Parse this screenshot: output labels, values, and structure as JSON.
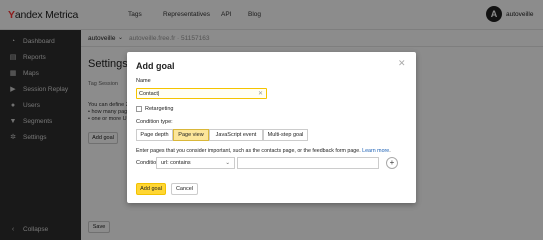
{
  "header": {
    "logo_y": "Y",
    "logo_rest": "andex Metrica",
    "nav": [
      "Tags",
      "Representatives",
      "API",
      "Blog"
    ],
    "avatar_letter": "A",
    "username": "autoveille"
  },
  "sidebar": {
    "items": [
      {
        "label": "Dashboard",
        "icon": "dashboard-icon"
      },
      {
        "label": "Reports",
        "icon": "reports-icon"
      },
      {
        "label": "Maps",
        "icon": "maps-icon"
      },
      {
        "label": "Session Replay",
        "icon": "play-icon"
      },
      {
        "label": "Users",
        "icon": "user-icon"
      },
      {
        "label": "Segments",
        "icon": "filter-icon"
      },
      {
        "label": "Settings",
        "icon": "gear-icon"
      }
    ],
    "collapse": "Collapse"
  },
  "content": {
    "counter_name": "autoveille",
    "counter_site": "autoveille.free.fr · 51157163",
    "page_title": "Settings",
    "tabs_text": "Tag   Session",
    "desc_lines": [
      "You can define 2",
      "• how many page",
      "• one or more UR"
    ],
    "add_goal_bg": "Add goal",
    "save": "Save"
  },
  "modal": {
    "title": "Add goal",
    "name_label": "Name",
    "name_value": "Contact|",
    "retargeting_label": "Retargeting",
    "condition_type_label": "Condition type:",
    "condition_types": [
      {
        "label": "Page depth",
        "active": false
      },
      {
        "label": "Page view",
        "active": true
      },
      {
        "label": "JavaScript event",
        "active": false
      },
      {
        "label": "Multi-step goal",
        "active": false
      }
    ],
    "hint": "Enter pages that you consider important, such as the contacts page, or the feedback form page.",
    "hint_more": "Learn more",
    "condition_label": "Condition",
    "condition_select": "url: contains",
    "add_button": "Add goal",
    "cancel_button": "Cancel"
  },
  "colors": {
    "accent_yellow": "#ffd633",
    "sidebar_bg": "#2f2f2f",
    "active_tab": "#fce69a",
    "link": "#1a5fb4"
  }
}
